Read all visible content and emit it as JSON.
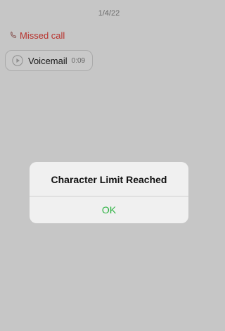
{
  "thread": {
    "date": "1/4/22",
    "missed_call": {
      "icon": "phone-icon",
      "label": "Missed call",
      "color": "#b8332e"
    },
    "voicemail": {
      "icon": "play-icon",
      "label": "Voicemail",
      "duration": "0:09"
    }
  },
  "alert": {
    "title": "Character Limit Reached",
    "ok_label": "OK",
    "ok_color": "#2fb344"
  }
}
